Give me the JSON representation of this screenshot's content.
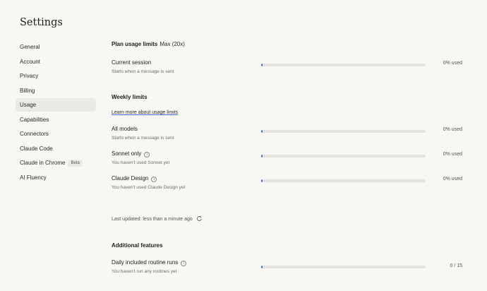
{
  "page_title": "Settings",
  "sidebar": {
    "items": [
      {
        "label": "General"
      },
      {
        "label": "Account"
      },
      {
        "label": "Privacy"
      },
      {
        "label": "Billing"
      },
      {
        "label": "Usage",
        "active": true
      },
      {
        "label": "Capabilities"
      },
      {
        "label": "Connectors"
      },
      {
        "label": "Claude Code"
      },
      {
        "label": "Claude in Chrome",
        "badge": "Beta"
      },
      {
        "label": "AI Fluency"
      }
    ]
  },
  "plan": {
    "title": "Plan usage limits",
    "plan_name": "Max (20x)",
    "current_session": {
      "label": "Current session",
      "sub": "Starts when a message is sent",
      "used_text": "0% used",
      "used_fraction": 0
    }
  },
  "weekly": {
    "title": "Weekly limits",
    "learn_more": "Learn more about usage limits",
    "all_models": {
      "label": "All models",
      "sub": "Starts when a message is sent",
      "used_text": "0% used",
      "used_fraction": 0
    },
    "sonnet": {
      "label": "Sonnet only",
      "sub": "You haven't used Sonnet yet",
      "used_text": "0% used",
      "used_fraction": 0
    },
    "design": {
      "label": "Claude Design",
      "sub": "You haven't used Claude Design yet",
      "used_text": "0% used",
      "used_fraction": 0
    }
  },
  "last_updated": "Last updated: less than a minute ago",
  "additional": {
    "title": "Additional features",
    "routines": {
      "label": "Daily included routine runs",
      "sub": "You haven't run any routines yet",
      "used_text": "0 / 15",
      "used_fraction": 0
    }
  },
  "colors": {
    "accent": "#3a6fd8",
    "background": "#f8f7f4",
    "track": "#e4e2dd",
    "active_nav": "#ebe9e4"
  }
}
